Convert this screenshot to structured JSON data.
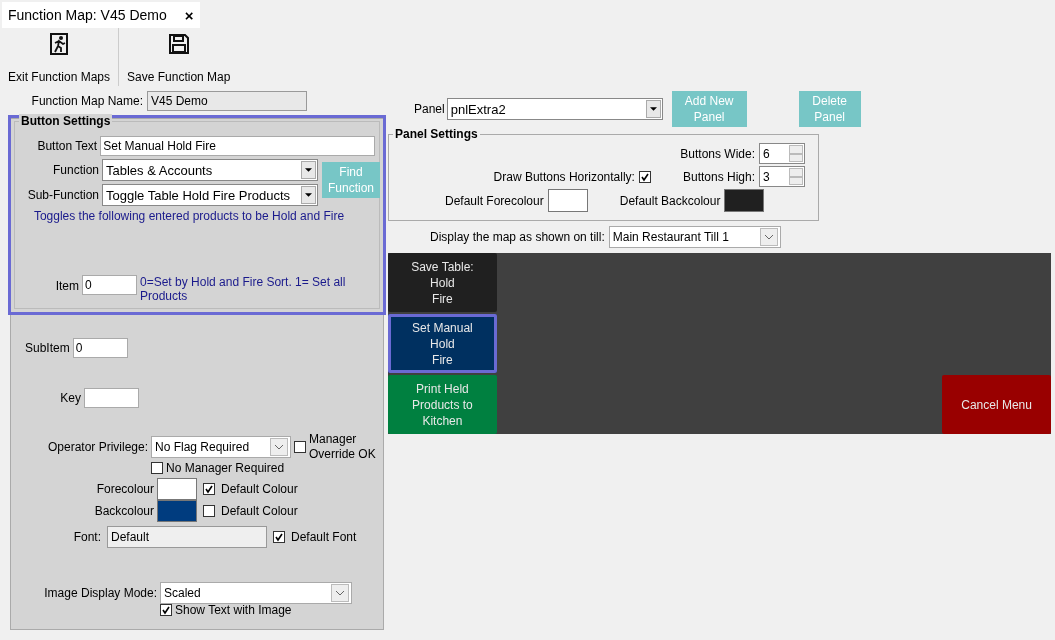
{
  "tab": {
    "title": "Function Map: V45 Demo",
    "close": "×"
  },
  "toolbar": [
    {
      "kind": "exit",
      "label": "Exit Function Maps"
    },
    {
      "kind": "save",
      "label": "Save Function Map"
    }
  ],
  "map_name": {
    "label": "Function Map Name:",
    "value": "V45 Demo"
  },
  "button_settings": {
    "title": "Button Settings",
    "highlighted": true,
    "button_text": {
      "label": "Button Text",
      "value": "Set Manual Hold Fire"
    },
    "function": {
      "label": "Function",
      "value": "Tables & Accounts"
    },
    "sub_function": {
      "label": "Sub-Function",
      "value": "Toggle Table Hold Fire Products"
    },
    "find_function": "Find Function",
    "description": "Toggles the following entered products to be Hold and Fire",
    "item": {
      "label": "Item",
      "value": "0",
      "hint": "0=Set by Hold and Fire Sort. 1= Set all Products"
    },
    "subitem": {
      "label": "SubItem",
      "value": "0"
    },
    "key": {
      "label": "Key"
    },
    "operator_privilege": {
      "label": "Operator Privilege:",
      "value": "No Flag Required"
    },
    "manager_override": {
      "label": "Manager Override OK",
      "checked": false
    },
    "no_manager": {
      "label": "No Manager Required",
      "checked": false
    },
    "forecolour": {
      "label": "Forecolour",
      "color": "#ffffff",
      "default_label": "Default Colour",
      "checked": true
    },
    "backcolour": {
      "label": "Backcolour",
      "color": "#003c7f",
      "default_label": "Default Colour",
      "checked": false
    },
    "font": {
      "label": "Font:",
      "value": "Default",
      "default_label": "Default Font",
      "checked": true
    },
    "image_mode": {
      "label": "Image Display Mode:",
      "value": "Scaled"
    },
    "show_text": {
      "label": "Show Text with Image",
      "checked": true
    }
  },
  "panel": {
    "label": "Panel",
    "value": "pnlExtra2",
    "add": "Add New Panel",
    "delete": "Delete Panel"
  },
  "panel_settings": {
    "title": "Panel Settings",
    "wide": {
      "label": "Buttons Wide:",
      "value": "6"
    },
    "high": {
      "label": "Buttons High:",
      "value": "3"
    },
    "horizontal": {
      "label": "Draw Buttons Horizontally:",
      "checked": true
    },
    "forecolour": {
      "label": "Default Forecolour",
      "color": "#ffffff"
    },
    "backcolour": {
      "label": "Default Backcolour",
      "color": "#202020"
    }
  },
  "till": {
    "label": "Display the map as shown on till:",
    "value": "Main Restaurant Till 1"
  },
  "map_rows": [
    [
      {
        "kind": "button",
        "lines": [
          "Save Table:",
          "Hold",
          "Fire"
        ],
        "color": "#202020",
        "selected": false
      },
      {
        "kind": "empty"
      },
      {
        "kind": "empty"
      },
      {
        "kind": "empty"
      },
      {
        "kind": "empty"
      },
      {
        "kind": "empty"
      }
    ],
    [
      {
        "kind": "button",
        "lines": [
          "Set Manual",
          "Hold",
          "Fire"
        ],
        "color": "#003060",
        "selected": true
      },
      {
        "kind": "empty"
      },
      {
        "kind": "empty"
      },
      {
        "kind": "empty"
      },
      {
        "kind": "empty"
      },
      {
        "kind": "empty"
      }
    ],
    [
      {
        "kind": "button",
        "lines": [
          "Print Held",
          "Products to",
          "Kitchen"
        ],
        "color": "#008040",
        "selected": false
      },
      {
        "kind": "empty"
      },
      {
        "kind": "empty"
      },
      {
        "kind": "empty"
      },
      {
        "kind": "empty"
      },
      {
        "kind": "button",
        "lines": [
          "Cancel Menu"
        ],
        "color": "#990000",
        "selected": false
      }
    ]
  ]
}
